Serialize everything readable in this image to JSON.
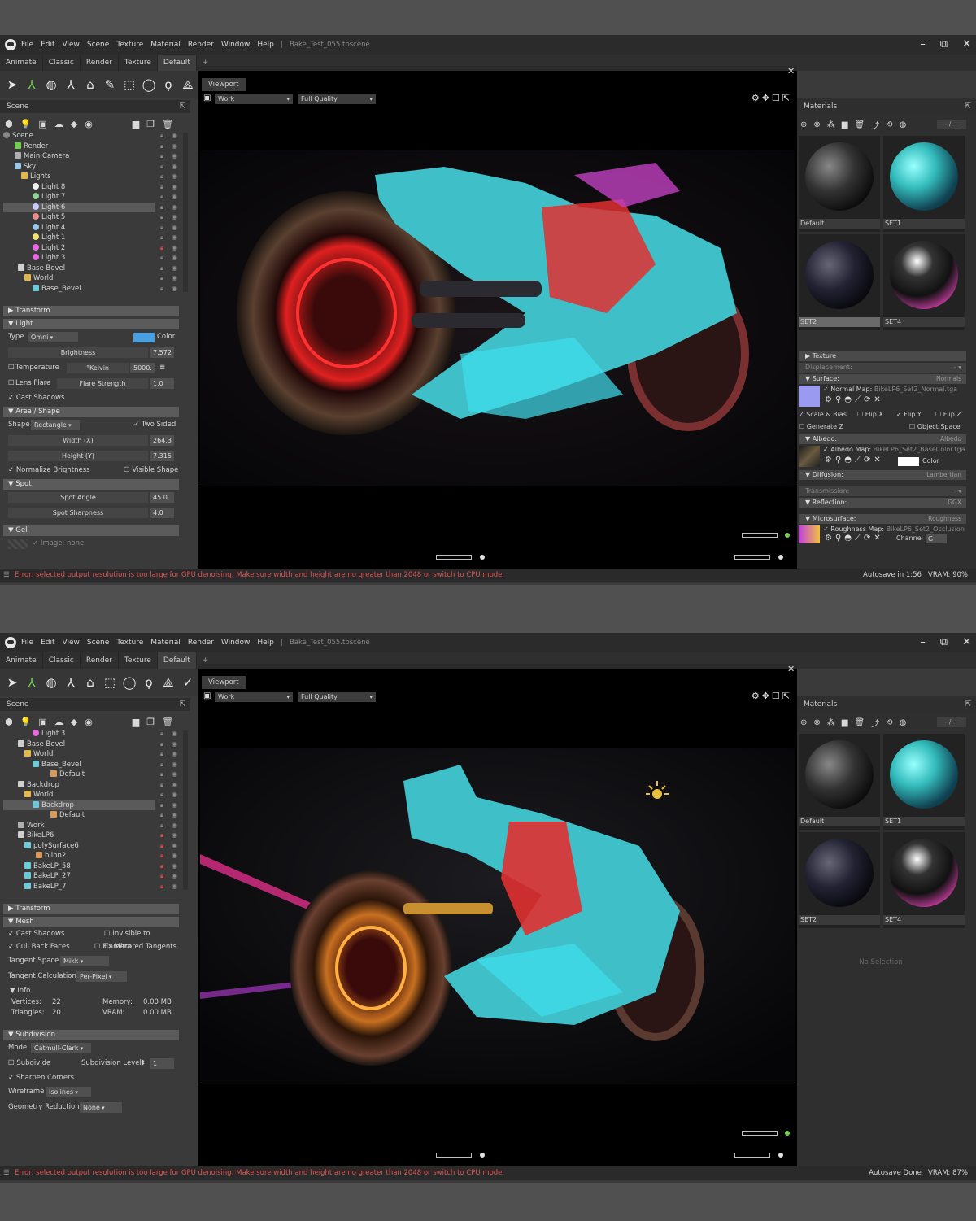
{
  "menu": [
    "File",
    "Edit",
    "View",
    "Scene",
    "Texture",
    "Material",
    "Render",
    "Window",
    "Help"
  ],
  "document_title": "Bake_Test_055.tbscene",
  "tabs": [
    "Animate",
    "Classic",
    "Render",
    "Texture",
    "Default"
  ],
  "tab_plus": "+",
  "viewport_tab": "Viewport",
  "camera_select": "Work",
  "quality_select": "Full Quality",
  "scene_label": "Scene",
  "materials_label": "Materials",
  "materials_search": "- / +",
  "materials": [
    "Default",
    "SET1",
    "SET2",
    "SET4"
  ],
  "status_error": "Error: selected output resolution is too large for GPU denoising. Make sure width and height are no greater than 2048 or switch to CPU mode.",
  "top": {
    "tree": [
      "Scene",
      "Render",
      "Main Camera",
      "Sky",
      "Lights",
      "Light 8",
      "Light 7",
      "Light 6",
      "Light 5",
      "Light 4",
      "Light 1",
      "Light 2",
      "Light 3",
      "Base Bevel",
      "World",
      "Base_Bevel"
    ],
    "transform": "Transform",
    "light": {
      "section": "Light",
      "type_label": "Type",
      "type_value": "Omni",
      "color_label": "Color",
      "brightness_label": "Brightness",
      "brightness_value": "7.572",
      "temperature_label": "Temperature",
      "kelvin_label": "°Kelvin",
      "kelvin_value": "5000.",
      "lens_flare_label": "Lens Flare",
      "flare_strength_label": "Flare Strength",
      "flare_strength_value": "1.0",
      "cast_shadows": "Cast Shadows"
    },
    "area": {
      "section": "Area / Shape",
      "shape_label": "Shape",
      "shape_value": "Rectangle",
      "two_sided": "Two Sided",
      "width_label": "Width (X)",
      "width_value": "264.3",
      "height_label": "Height (Y)",
      "height_value": "7.315",
      "normalize": "Normalize Brightness",
      "visible_shape": "Visible Shape"
    },
    "spot": {
      "section": "Spot",
      "angle_label": "Spot Angle",
      "angle_value": "45.0",
      "sharpness_label": "Spot Sharpness",
      "sharpness_value": "4.0"
    },
    "gel": {
      "section": "Gel",
      "image": "Image: none"
    },
    "texture": {
      "texture_section": "Texture",
      "displacement": "Displacement:",
      "surface": "Surface:",
      "surface_value": "Normals",
      "normal_map": "Normal Map:",
      "normal_file": "BikeLP6_Set2_Normal.tga",
      "scale_bias": "Scale & Bias",
      "flip_x": "Flip X",
      "flip_y": "Flip Y",
      "flip_z": "Flip Z",
      "generate_z": "Generate Z",
      "object_space": "Object Space",
      "albedo": "Albedo:",
      "albedo_value": "Albedo",
      "albedo_map": "Albedo Map:",
      "albedo_file": "BikeLP6_Set2_BaseColor.tga",
      "color_label": "Color",
      "diffusion": "Diffusion:",
      "diffusion_value": "Lambertian",
      "transmission": "Transmission:",
      "reflection": "Reflection:",
      "reflection_value": "GGX",
      "microsurface": "Microsurface:",
      "microsurface_value": "Roughness",
      "roughness_map": "Roughness Map:",
      "roughness_file": "BikeLP6_Set2_Occlusion",
      "channel_label": "Channel",
      "channel_value": "G"
    },
    "status_right_a": "Autosave in 1:56",
    "status_right_b": "VRAM: 90%"
  },
  "bottom": {
    "tree": [
      "Light 3",
      "Base Bevel",
      "World",
      "Base_Bevel",
      "Default",
      "Backdrop",
      "World",
      "Backdrop",
      "Default",
      "Work",
      "BikeLP6",
      "polySurface6",
      "blinn2",
      "BakeLP_58",
      "BakeLP_27",
      "BakeLP_7"
    ],
    "transform": "Transform",
    "mesh": {
      "section": "Mesh",
      "cast_shadows": "Cast Shadows",
      "invisible_camera": "Invisible to Camera",
      "cull_back": "Cull Back Faces",
      "fix_mirrored": "Fix Mirrored Tangents",
      "tangent_space_label": "Tangent Space",
      "tangent_space_value": "Mikk",
      "tangent_calc_label": "Tangent Calculation",
      "tangent_calc_value": "Per-Pixel",
      "info": "Info",
      "vertices_label": "Vertices:",
      "vertices_value": "22",
      "triangles_label": "Triangles:",
      "triangles_value": "20",
      "memory_label": "Memory:",
      "memory_value": "0.00 MB",
      "vram_label": "VRAM:",
      "vram_value": "0.00 MB"
    },
    "subdivision": {
      "section": "Subdivision",
      "mode_label": "Mode",
      "mode_value": "Catmull-Clark",
      "subdivide": "Subdivide",
      "level_label": "Subdivision Level",
      "level_value": "1",
      "sharpen": "Sharpen Corners",
      "wireframe_label": "Wireframe",
      "wireframe_value": "Isolines",
      "geo_reduction_label": "Geometry Reduction",
      "geo_reduction_value": "None"
    },
    "no_selection": "No Selection",
    "status_right_a": "Autosave Done",
    "status_right_b": "VRAM: 87%"
  },
  "colors": {
    "accent_green": "#6fd14a",
    "error_red": "#e25555",
    "light_color": "#4a9fe0",
    "selection": "#5a5a5a"
  }
}
